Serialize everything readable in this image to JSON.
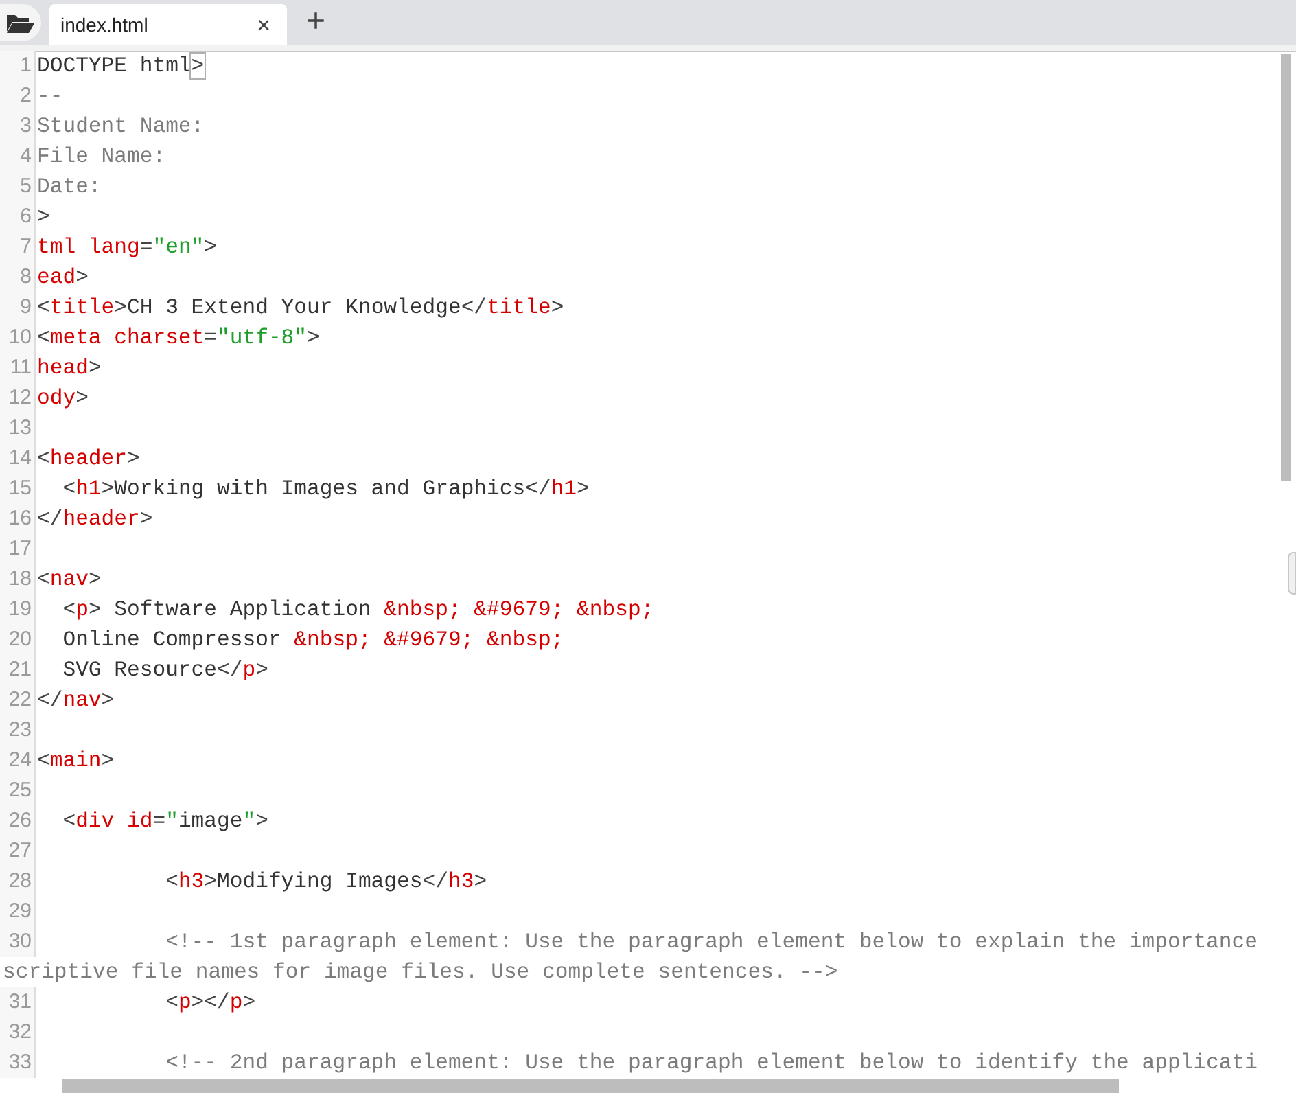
{
  "tabs": [
    {
      "label": "index.html",
      "selected": true,
      "close": "×"
    }
  ],
  "new_tab": "+",
  "lines": [
    {
      "number": "1",
      "tokens": [
        {
          "kind": "text",
          "text": "DOCTYPE html"
        },
        {
          "kind": "match",
          "text": ">"
        }
      ]
    },
    {
      "number": "2",
      "tokens": [
        {
          "kind": "comment",
          "text": "--"
        }
      ]
    },
    {
      "number": "3",
      "tokens": [
        {
          "kind": "comment",
          "text": "Student Name:"
        }
      ]
    },
    {
      "number": "4",
      "tokens": [
        {
          "kind": "comment",
          "text": "File Name:"
        }
      ]
    },
    {
      "number": "5",
      "tokens": [
        {
          "kind": "comment",
          "text": "Date:"
        }
      ]
    },
    {
      "number": "6",
      "tokens": [
        {
          "kind": "punct",
          "text": ">"
        }
      ]
    },
    {
      "number": "7",
      "tokens": [
        {
          "kind": "tag",
          "text": "tml lang"
        },
        {
          "kind": "punct",
          "text": "="
        },
        {
          "kind": "string",
          "text": "\"en\""
        },
        {
          "kind": "punct",
          "text": ">"
        }
      ]
    },
    {
      "number": "8",
      "tokens": [
        {
          "kind": "tag",
          "text": "ead"
        },
        {
          "kind": "punct",
          "text": ">"
        }
      ]
    },
    {
      "number": "9",
      "tokens": [
        {
          "kind": "punct",
          "text": "<"
        },
        {
          "kind": "tag",
          "text": "title"
        },
        {
          "kind": "punct",
          "text": ">"
        },
        {
          "kind": "text",
          "text": "CH 3 Extend Your Knowledge"
        },
        {
          "kind": "punct",
          "text": "</"
        },
        {
          "kind": "tag",
          "text": "title"
        },
        {
          "kind": "punct",
          "text": ">"
        }
      ]
    },
    {
      "number": "10",
      "tokens": [
        {
          "kind": "punct",
          "text": "<"
        },
        {
          "kind": "tag",
          "text": "meta charset"
        },
        {
          "kind": "punct",
          "text": "="
        },
        {
          "kind": "string",
          "text": "\"utf-8\""
        },
        {
          "kind": "punct",
          "text": ">"
        }
      ]
    },
    {
      "number": "11",
      "tokens": [
        {
          "kind": "tag",
          "text": "head"
        },
        {
          "kind": "punct",
          "text": ">"
        }
      ]
    },
    {
      "number": "12",
      "tokens": [
        {
          "kind": "tag",
          "text": "ody"
        },
        {
          "kind": "punct",
          "text": ">"
        }
      ]
    },
    {
      "number": "13"
    },
    {
      "number": "14",
      "tokens": [
        {
          "kind": "punct",
          "text": "<"
        },
        {
          "kind": "tag",
          "text": "header"
        },
        {
          "kind": "punct",
          "text": ">"
        }
      ]
    },
    {
      "number": "15",
      "tokens": [
        {
          "kind": "punct",
          "text": "  <"
        },
        {
          "kind": "tag",
          "text": "h1"
        },
        {
          "kind": "punct",
          "text": ">"
        },
        {
          "kind": "text",
          "text": "Working with Images and Graphics"
        },
        {
          "kind": "punct",
          "text": "</"
        },
        {
          "kind": "tag",
          "text": "h1"
        },
        {
          "kind": "punct",
          "text": ">"
        }
      ]
    },
    {
      "number": "16",
      "tokens": [
        {
          "kind": "punct",
          "text": "</"
        },
        {
          "kind": "tag",
          "text": "header"
        },
        {
          "kind": "punct",
          "text": ">"
        }
      ]
    },
    {
      "number": "17"
    },
    {
      "number": "18",
      "tokens": [
        {
          "kind": "punct",
          "text": "<"
        },
        {
          "kind": "tag",
          "text": "nav"
        },
        {
          "kind": "punct",
          "text": ">"
        }
      ]
    },
    {
      "number": "19",
      "tokens": [
        {
          "kind": "punct",
          "text": "  <"
        },
        {
          "kind": "tag",
          "text": "p"
        },
        {
          "kind": "punct",
          "text": ">"
        },
        {
          "kind": "text",
          "text": " Software Application "
        },
        {
          "kind": "entity",
          "text": "&nbsp; &#9679; &nbsp;"
        }
      ]
    },
    {
      "number": "20",
      "tokens": [
        {
          "kind": "text",
          "text": "  Online Compressor "
        },
        {
          "kind": "entity",
          "text": "&nbsp; &#9679; &nbsp;"
        }
      ]
    },
    {
      "number": "21",
      "tokens": [
        {
          "kind": "text",
          "text": "  SVG Resource"
        },
        {
          "kind": "punct",
          "text": "</"
        },
        {
          "kind": "tag",
          "text": "p"
        },
        {
          "kind": "punct",
          "text": ">"
        }
      ]
    },
    {
      "number": "22",
      "tokens": [
        {
          "kind": "punct",
          "text": "</"
        },
        {
          "kind": "tag",
          "text": "nav"
        },
        {
          "kind": "punct",
          "text": ">"
        }
      ]
    },
    {
      "number": "23"
    },
    {
      "number": "24",
      "tokens": [
        {
          "kind": "punct",
          "text": "<"
        },
        {
          "kind": "tag",
          "text": "main"
        },
        {
          "kind": "punct",
          "text": ">"
        }
      ]
    },
    {
      "number": "25"
    },
    {
      "number": "26",
      "tokens": [
        {
          "kind": "punct",
          "text": "  <"
        },
        {
          "kind": "tag",
          "text": "div id"
        },
        {
          "kind": "punct",
          "text": "="
        },
        {
          "kind": "string",
          "text": "\""
        },
        {
          "kind": "text",
          "text": "image"
        },
        {
          "kind": "string",
          "text": "\""
        },
        {
          "kind": "punct",
          "text": ">"
        }
      ]
    },
    {
      "number": "27"
    },
    {
      "number": "28",
      "tokens": [
        {
          "kind": "punct",
          "text": "          <"
        },
        {
          "kind": "tag",
          "text": "h3"
        },
        {
          "kind": "punct",
          "text": ">"
        },
        {
          "kind": "text",
          "text": "Modifying Images"
        },
        {
          "kind": "punct",
          "text": "</"
        },
        {
          "kind": "tag",
          "text": "h3"
        },
        {
          "kind": "punct",
          "text": ">"
        }
      ]
    },
    {
      "number": "29"
    },
    {
      "number": "30",
      "tokens": [
        {
          "kind": "comment",
          "text": "          <!-- 1st paragraph element: Use the paragraph element below to explain the importance"
        }
      ],
      "continuation": [
        {
          "kind": "comment",
          "text": "scriptive file names for image files. Use complete sentences. -->"
        }
      ]
    },
    {
      "number": "31",
      "tokens": [
        {
          "kind": "punct",
          "text": "          <"
        },
        {
          "kind": "tag",
          "text": "p"
        },
        {
          "kind": "punct",
          "text": "></"
        },
        {
          "kind": "tag",
          "text": "p"
        },
        {
          "kind": "punct",
          "text": ">"
        }
      ]
    },
    {
      "number": "32"
    },
    {
      "number": "33",
      "tokens": [
        {
          "kind": "comment",
          "text": "          <!-- 2nd paragraph element: Use the paragraph element below to identify the applicati"
        }
      ]
    }
  ]
}
